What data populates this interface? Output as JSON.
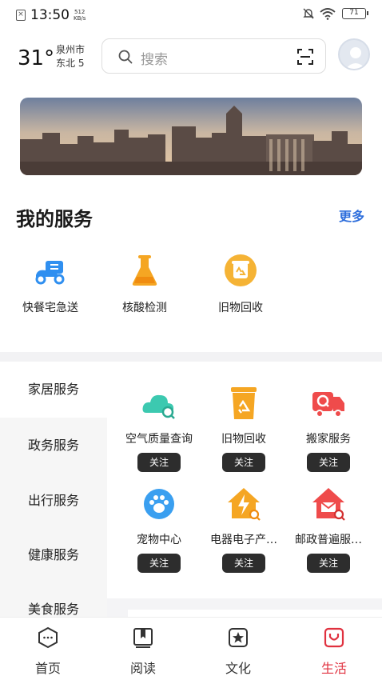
{
  "status_bar": {
    "time": "13:50",
    "speed_value": "512",
    "speed_unit": "KB/s",
    "battery": "71"
  },
  "header": {
    "temperature": "31°",
    "city": "泉州市",
    "wind": "东北 5",
    "search_placeholder": "搜索"
  },
  "my_services": {
    "title": "我的服务",
    "more": "更多",
    "items": [
      {
        "label": "快餐宅急送",
        "icon": "delivery-scooter-icon",
        "color": "#2f8ff0"
      },
      {
        "label": "核酸检测",
        "icon": "flask-icon",
        "color": "#f5a623"
      },
      {
        "label": "旧物回收",
        "icon": "recycle-badge-icon",
        "color": "#f5b335"
      }
    ]
  },
  "categories": {
    "items": [
      "家居服务",
      "政务服务",
      "出行服务",
      "健康服务",
      "美食服务"
    ],
    "active": "家居服务"
  },
  "grid": {
    "follow_label": "关注",
    "items": [
      {
        "label": "空气质量查询",
        "icon": "air-cloud-icon",
        "color": "#3cc9b0"
      },
      {
        "label": "旧物回收",
        "icon": "recycle-bin-icon",
        "color": "#f5a623"
      },
      {
        "label": "搬家服务",
        "icon": "moving-truck-icon",
        "color": "#ef4b4b"
      },
      {
        "label": "宠物中心",
        "icon": "paw-icon",
        "color": "#3a9ff0"
      },
      {
        "label": "电器电子产…",
        "icon": "electric-house-icon",
        "color": "#f5a623"
      },
      {
        "label": "邮政普遍服…",
        "icon": "mail-house-icon",
        "color": "#ef4b4b"
      }
    ]
  },
  "bottom_nav": {
    "items": [
      {
        "label": "首页",
        "icon": "home-icon"
      },
      {
        "label": "阅读",
        "icon": "book-icon"
      },
      {
        "label": "文化",
        "icon": "star-frame-icon"
      },
      {
        "label": "生活",
        "icon": "life-bag-icon"
      }
    ],
    "active": "生活",
    "active_color": "#e0313f"
  }
}
